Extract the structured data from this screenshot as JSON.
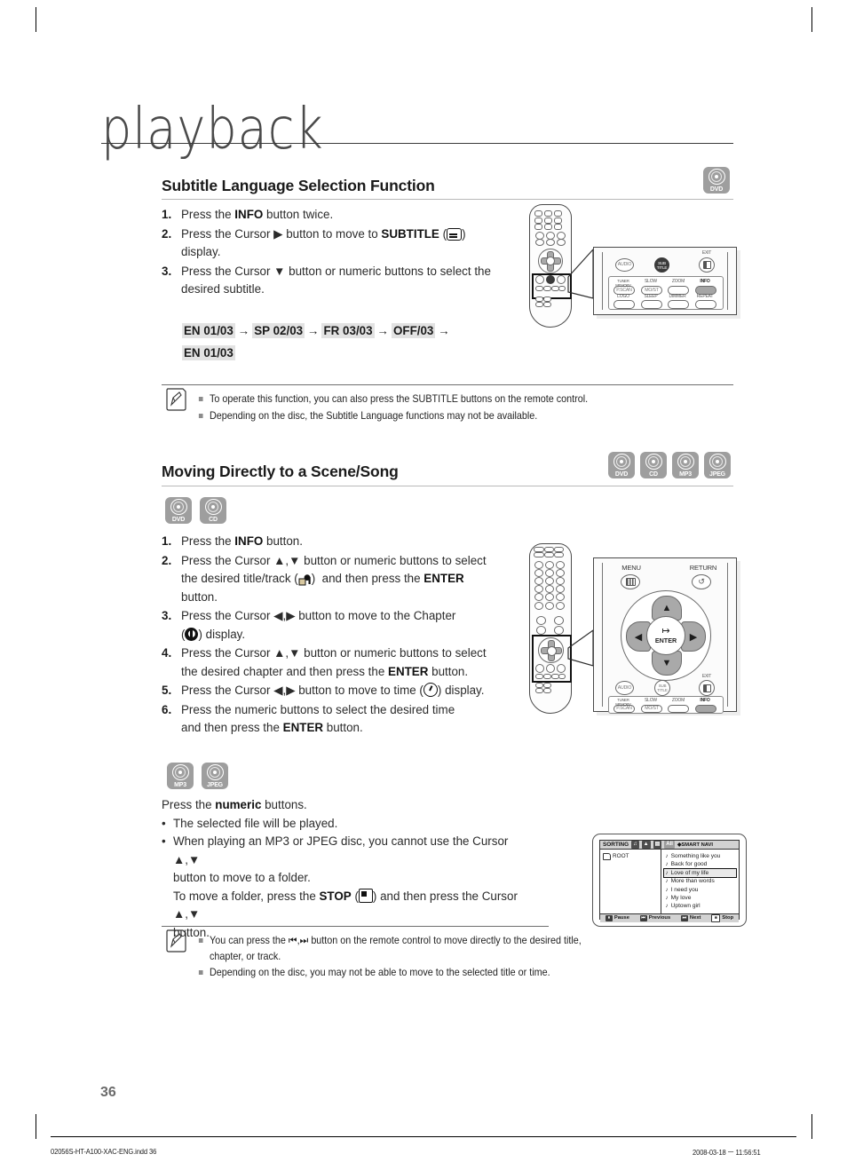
{
  "chapter": {
    "title": "playback"
  },
  "page": {
    "number": "36"
  },
  "footer": {
    "file": "02056S-HT-A100-XAC-ENG.indd   36",
    "timestamp": "2008-03-18   ㅡ 11:56:51"
  },
  "section1": {
    "heading": "Subtitle Language Selection Function",
    "badges": [
      {
        "label": "DVD",
        "icon": "disc-icon"
      }
    ],
    "steps": [
      {
        "num": "1.",
        "parts": [
          {
            "t": "Press the "
          },
          {
            "t": "INFO",
            "bold": true
          },
          {
            "t": " button twice."
          }
        ]
      },
      {
        "num": "2.",
        "parts": [
          {
            "t": "Press the Cursor ▶ button to move to "
          },
          {
            "t": "SUBTITLE",
            "bold": true
          },
          {
            "t": " ("
          },
          {
            "icon": "subtitle-icon"
          },
          {
            "t": ")"
          },
          {
            "br": true
          },
          {
            "t": "display."
          }
        ]
      },
      {
        "num": "3.",
        "parts": [
          {
            "t": "Press the Cursor ▼ button or numeric buttons to select the"
          },
          {
            "br": true
          },
          {
            "t": "desired subtitle."
          }
        ]
      }
    ],
    "flow": {
      "items": [
        "EN 01/03",
        "SP 02/03",
        "FR 03/03",
        "OFF/03",
        "EN 01/03"
      ],
      "arrow": "→"
    },
    "notes": [
      "To operate this function, you can also press the SUBTITLE buttons on the remote control.",
      "Depending on the disc, the Subtitle Language functions may not be available."
    ]
  },
  "section2": {
    "heading": "Moving Directly to a Scene/Song",
    "heading_badges": [
      {
        "label": "DVD"
      },
      {
        "label": "CD"
      },
      {
        "label": "MP3"
      },
      {
        "label": "JPEG"
      }
    ],
    "badges_dvd_cd": [
      {
        "label": "DVD"
      },
      {
        "label": "CD"
      }
    ],
    "steps": [
      {
        "num": "1.",
        "parts": [
          {
            "t": "Press the "
          },
          {
            "t": "INFO",
            "bold": true
          },
          {
            "t": " button."
          }
        ]
      },
      {
        "num": "2.",
        "parts": [
          {
            "t": "Press the Cursor ▲,▼ button or numeric buttons to select"
          },
          {
            "br": true
          },
          {
            "t": "the desired title/track ("
          },
          {
            "icon": "title-icon"
          },
          {
            "t": ")  and then press the "
          },
          {
            "t": "ENTER",
            "bold": true
          },
          {
            "br": true
          },
          {
            "t": "button."
          }
        ]
      },
      {
        "num": "3.",
        "parts": [
          {
            "t": "Press the Cursor ◀,▶ button to move to the Chapter"
          },
          {
            "br": true
          },
          {
            "t": "("
          },
          {
            "icon": "chapter-icon"
          },
          {
            "t": ") display."
          }
        ]
      },
      {
        "num": "4.",
        "parts": [
          {
            "t": "Press the Cursor ▲,▼ button or numeric buttons to select"
          },
          {
            "br": true
          },
          {
            "t": "the desired chapter and then press the "
          },
          {
            "t": "ENTER",
            "bold": true
          },
          {
            "t": " button."
          }
        ]
      },
      {
        "num": "5.",
        "parts": [
          {
            "t": "Press the Cursor ◀,▶ button to move to time ("
          },
          {
            "icon": "time-icon"
          },
          {
            "t": ") display."
          }
        ]
      },
      {
        "num": "6.",
        "parts": [
          {
            "t": "Press the numeric buttons to select the desired time"
          },
          {
            "br": true
          },
          {
            "t": "and then press the "
          },
          {
            "t": "ENTER",
            "bold": true
          },
          {
            "t": " button."
          }
        ]
      }
    ],
    "badges_mp3_jpeg": [
      {
        "label": "MP3"
      },
      {
        "label": "JPEG"
      }
    ],
    "mp3_intro": [
      {
        "t": "Press the "
      },
      {
        "t": "numeric",
        "bold": true
      },
      {
        "t": " buttons."
      }
    ],
    "mp3_bullets": [
      {
        "parts": [
          {
            "t": "The selected file will be played."
          }
        ]
      },
      {
        "parts": [
          {
            "t": "When playing an MP3 or JPEG disc, you cannot use the Cursor ▲,▼"
          },
          {
            "br": true
          },
          {
            "t": "button to move to a folder."
          },
          {
            "br": true
          },
          {
            "t": "To move a folder, press the "
          },
          {
            "t": "STOP",
            "bold": true
          },
          {
            "t": " ("
          },
          {
            "icon": "stop-icon"
          },
          {
            "t": ") and then press the Cursor ▲,▼"
          },
          {
            "br": true
          },
          {
            "t": "button."
          }
        ]
      }
    ],
    "notes": [
      "You can press the ⏮,⏭ button on the remote control to move directly to the desired title, chapter, or track.",
      "Depending on the disc, you may not be able to move to the selected title or time."
    ]
  },
  "remote1": {
    "top_row": [
      {
        "label": "AUDIO",
        "style": "plain"
      },
      {
        "label": "SUB TITLE",
        "style": "dark"
      },
      {
        "label": "EXIT",
        "style": "exit"
      }
    ],
    "exit_caption": "EXIT",
    "grid": [
      {
        "caption": "TUNER MEMORY",
        "label": "P.SCAN",
        "style": "plain"
      },
      {
        "caption": "SLOW",
        "label": "MO/ST",
        "style": "plain"
      },
      {
        "caption": "ZOOM",
        "label": "",
        "style": "plain"
      },
      {
        "caption": "INFO",
        "label": "",
        "style": "gray"
      },
      {
        "caption": "LOGO",
        "label": "",
        "style": "plain"
      },
      {
        "caption": "SLEEP",
        "label": "",
        "style": "plain"
      },
      {
        "caption": "DIMMER",
        "label": "",
        "style": "plain"
      },
      {
        "caption": "REPEAT",
        "label": "",
        "style": "plain"
      }
    ]
  },
  "remote2": {
    "menu_label": "MENU",
    "return_label": "RETURN",
    "enter_label": "ENTER",
    "up": "▲",
    "down": "▼",
    "left": "◀",
    "right": "▶",
    "bottom_row": [
      {
        "label": "AUDIO",
        "style": "plain"
      },
      {
        "label": "SUB TITLE",
        "style": "plain"
      },
      {
        "label": "EXIT",
        "style": "exit"
      }
    ],
    "exit_caption": "EXIT",
    "grid": [
      {
        "caption": "TUNER MEMORY",
        "label": "P.SCAN",
        "style": "plain"
      },
      {
        "caption": "SLOW",
        "label": "MO/ST",
        "style": "plain"
      },
      {
        "caption": "ZOOM",
        "label": "",
        "style": "plain"
      },
      {
        "caption": "INFO",
        "label": "",
        "style": "gray"
      }
    ]
  },
  "osd": {
    "bar": {
      "title": "SORTING",
      "chips": [
        "♫",
        "▲",
        "▤",
        "All"
      ],
      "smart_navi": "SMART NAVI"
    },
    "root_label": "ROOT",
    "songs": [
      {
        "name": "Something like you",
        "selected": false
      },
      {
        "name": "Back for good",
        "selected": false
      },
      {
        "name": "Love of my life",
        "selected": true
      },
      {
        "name": "More than words",
        "selected": false
      },
      {
        "name": "I need you",
        "selected": false
      },
      {
        "name": "My love",
        "selected": false
      },
      {
        "name": "Uptown girl",
        "selected": false
      }
    ],
    "footer_items": [
      {
        "key": "⏸",
        "label": "Pause"
      },
      {
        "key": "⏮",
        "label": "Previous"
      },
      {
        "key": "⏭",
        "label": "Next"
      },
      {
        "key": "■",
        "label": "Stop",
        "white": true
      }
    ]
  }
}
